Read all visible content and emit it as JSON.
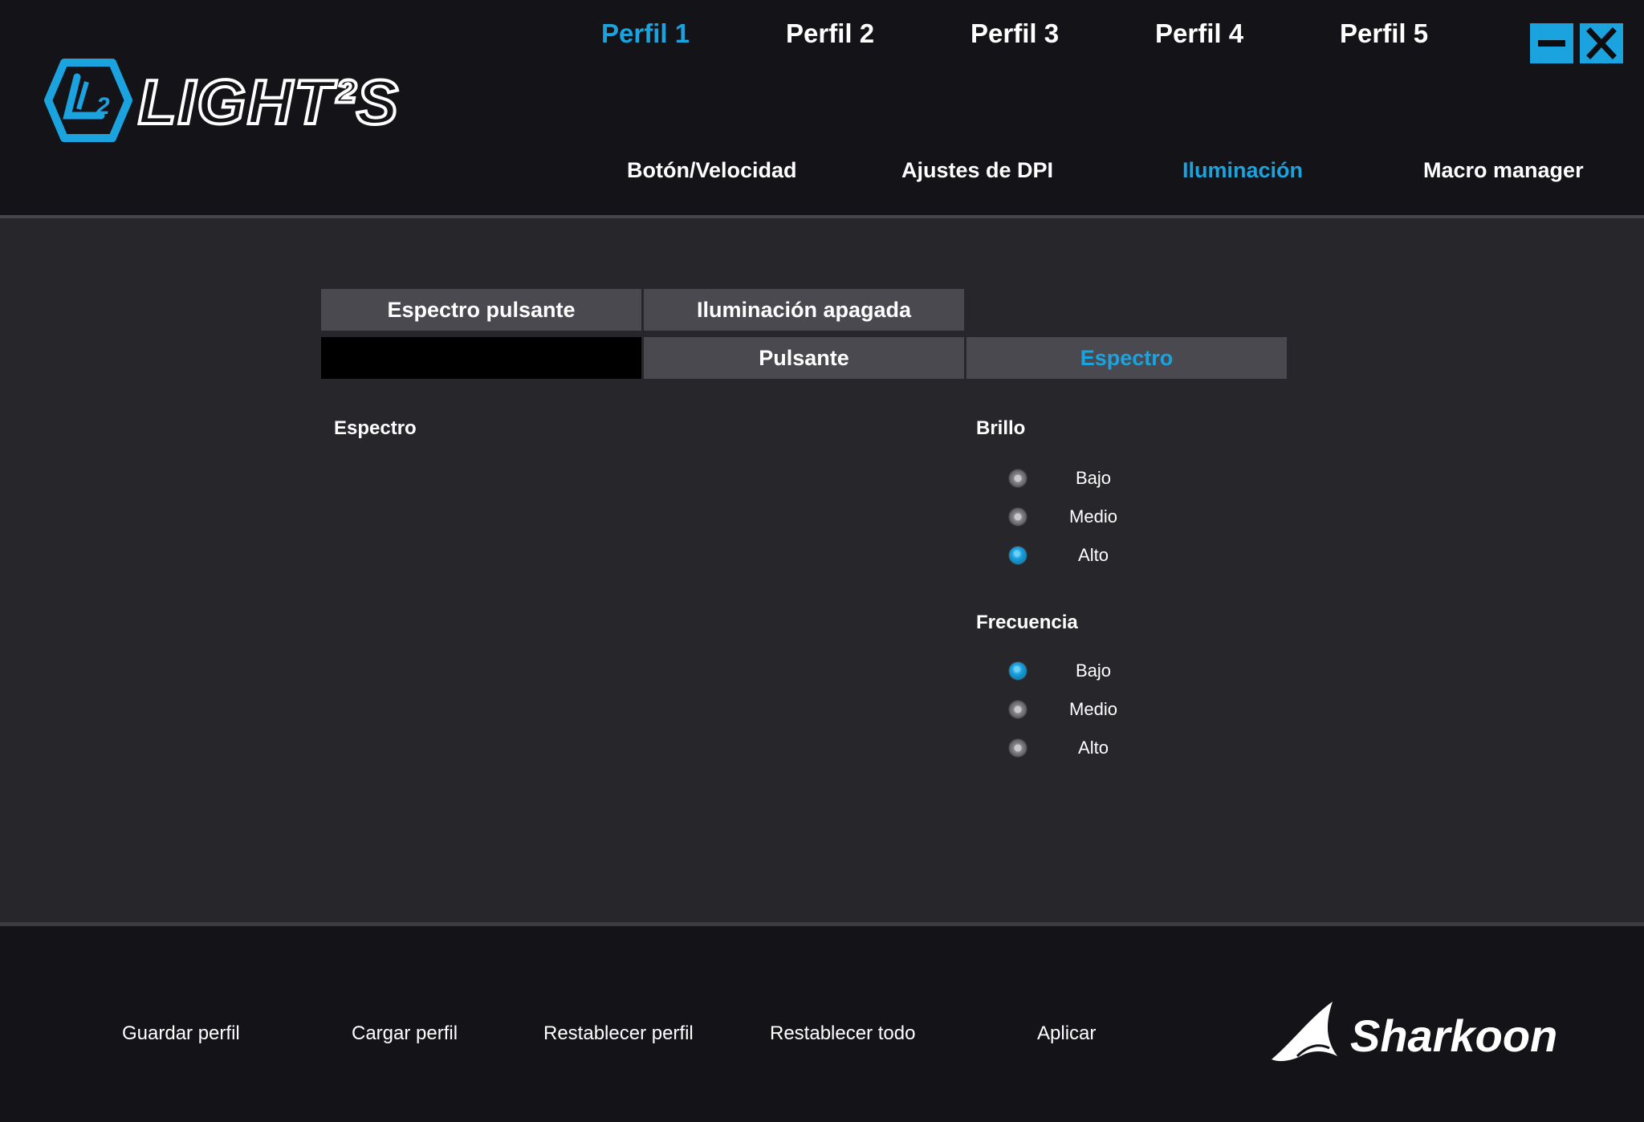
{
  "header": {
    "profiles": [
      {
        "label": "Perfil 1",
        "active": true
      },
      {
        "label": "Perfil 2",
        "active": false
      },
      {
        "label": "Perfil 3",
        "active": false
      },
      {
        "label": "Perfil 4",
        "active": false
      },
      {
        "label": "Perfil 5",
        "active": false
      }
    ],
    "window_controls": {
      "minimize": "minimize-icon",
      "close": "close-icon"
    },
    "main_tabs": [
      {
        "label": "Botón/Velocidad",
        "active": false
      },
      {
        "label": "Ajustes de DPI",
        "active": false
      },
      {
        "label": "Iluminación",
        "active": true
      },
      {
        "label": "Macro manager",
        "active": false
      }
    ],
    "logo": "LIGHT²S",
    "logo_icon": "light2-badge-icon"
  },
  "lighting": {
    "mode_tabs_row1": [
      {
        "label": "Espectro pulsante",
        "active": false
      },
      {
        "label": "Iluminación apagada",
        "active": false
      }
    ],
    "mode_tabs_row2": [
      {
        "label": "Pulsante",
        "active": false
      },
      {
        "label": "Espectro",
        "active": true
      }
    ],
    "color_swatch": "#000000",
    "effect_label": "Espectro",
    "brightness": {
      "title": "Brillo",
      "options": [
        {
          "label": "Bajo",
          "selected": false
        },
        {
          "label": "Medio",
          "selected": false
        },
        {
          "label": "Alto",
          "selected": true
        }
      ]
    },
    "frequency": {
      "title": "Frecuencia",
      "options": [
        {
          "label": "Bajo",
          "selected": true
        },
        {
          "label": "Medio",
          "selected": false
        },
        {
          "label": "Alto",
          "selected": false
        }
      ]
    }
  },
  "footer": {
    "buttons": [
      {
        "label": "Guardar perfil"
      },
      {
        "label": "Cargar perfil"
      },
      {
        "label": "Restablecer perfil"
      },
      {
        "label": "Restablecer todo"
      },
      {
        "label": "Aplicar"
      }
    ],
    "brand": "Sharkoon",
    "brand_icon": "shark-fin-icon"
  },
  "colors": {
    "accent": "#1ba3df",
    "header_bg": "#141318",
    "content_bg": "#27262b",
    "tab_bg": "#4a494f"
  }
}
